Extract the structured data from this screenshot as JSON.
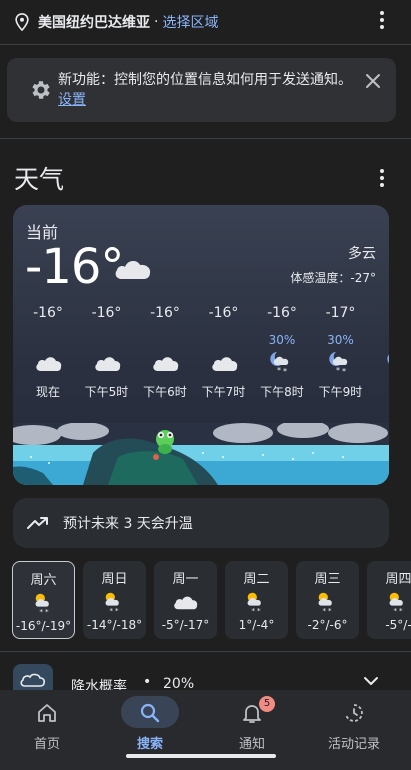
{
  "location": {
    "name": "美国纽约巴达维亚",
    "separator": "·",
    "change_label": "选择区域"
  },
  "notice": {
    "text": "新功能：控制您的位置信息如何用于发送通知。",
    "link": "设置"
  },
  "weather": {
    "section_title": "天气",
    "current_label": "当前",
    "current_temp": "-16°",
    "condition": "多云",
    "feels_like": "体感温度：-27°",
    "hourly": [
      {
        "temp": "-16°",
        "precip": "",
        "icon": "cloudy-icon",
        "label": "现在"
      },
      {
        "temp": "-16°",
        "precip": "",
        "icon": "cloudy-icon",
        "label": "下午5时"
      },
      {
        "temp": "-16°",
        "precip": "",
        "icon": "cloudy-icon",
        "label": "下午6时"
      },
      {
        "temp": "-16°",
        "precip": "",
        "icon": "cloudy-icon",
        "label": "下午7时"
      },
      {
        "temp": "-16°",
        "precip": "30%",
        "icon": "night-snow-icon",
        "label": "下午8时"
      },
      {
        "temp": "-17°",
        "precip": "30%",
        "icon": "night-snow-icon",
        "label": "下午9时"
      },
      {
        "temp": "-",
        "precip": "3",
        "icon": "night-snow-icon",
        "label": "下"
      }
    ],
    "trend_text": "预计未来 3 天会升温",
    "daily": [
      {
        "day": "周六",
        "icon": "snow-sun-icon",
        "range": "-16°/-19°",
        "selected": true
      },
      {
        "day": "周日",
        "icon": "snow-sun-icon",
        "range": "-14°/-18°",
        "selected": false
      },
      {
        "day": "周一",
        "icon": "cloudy-icon",
        "range": "-5°/-17°",
        "selected": false
      },
      {
        "day": "周二",
        "icon": "snow-sun-icon",
        "range": "1°/-4°",
        "selected": false
      },
      {
        "day": "周三",
        "icon": "snow-sun-icon",
        "range": "-2°/-6°",
        "selected": false
      },
      {
        "day": "周四",
        "icon": "snow-sun-icon",
        "range": "-5°/-",
        "selected": false
      }
    ],
    "precip_row": {
      "label": "降水概率",
      "dot": "•",
      "value": "20%"
    }
  },
  "nav": {
    "items": [
      {
        "label": "首页",
        "icon": "home-icon"
      },
      {
        "label": "搜索",
        "icon": "search-icon"
      },
      {
        "label": "通知",
        "icon": "bell-icon",
        "badge": "5"
      },
      {
        "label": "活动记录",
        "icon": "activity-icon"
      }
    ]
  },
  "colors": {
    "background": "#1f1f20",
    "accent": "#8ab4f8",
    "card": "#2a2d32"
  }
}
